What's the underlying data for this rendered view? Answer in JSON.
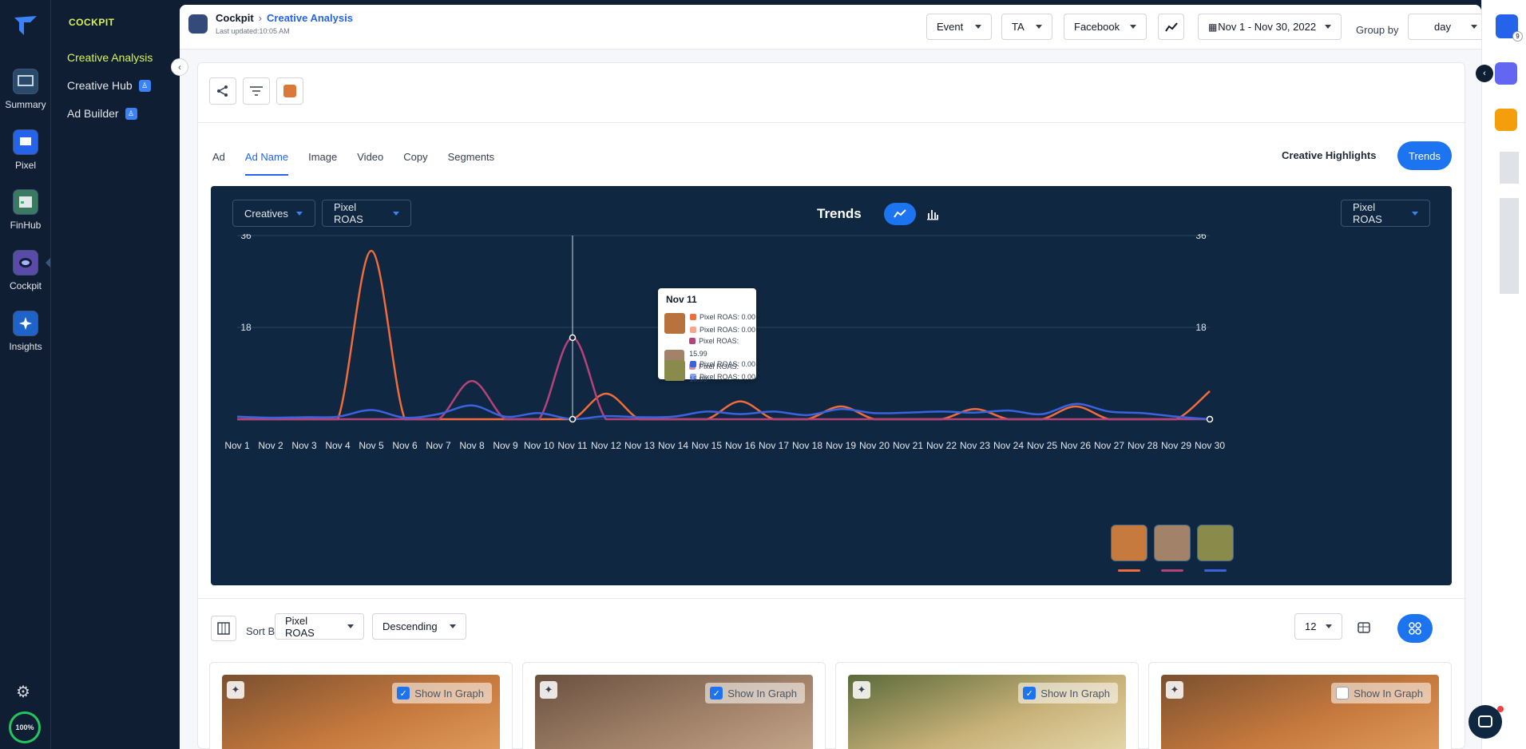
{
  "rail": {
    "items": [
      {
        "label": "Summary",
        "icon": "summary-icon"
      },
      {
        "label": "Pixel",
        "icon": "pixel-icon"
      },
      {
        "label": "FinHub",
        "icon": "finhub-icon"
      },
      {
        "label": "Cockpit",
        "icon": "cockpit-icon"
      },
      {
        "label": "Insights",
        "icon": "insights-icon"
      }
    ],
    "progress": "100%"
  },
  "sidebar": {
    "title": "COCKPIT",
    "items": [
      {
        "label": "Creative Analysis"
      },
      {
        "label": "Creative Hub"
      },
      {
        "label": "Ad Builder"
      }
    ]
  },
  "topbar": {
    "crumb_root": "Cockpit",
    "crumb_current": "Creative Analysis",
    "updated": "Last updated:10:05 AM",
    "event": "Event",
    "ta": "TA",
    "platform": "Facebook",
    "date_range": "Nov 1 - Nov 30, 2022",
    "group_by_label": "Group by",
    "group_by": "day",
    "avatar_badge": "9"
  },
  "tabs": [
    "Ad",
    "Ad Name",
    "Image",
    "Video",
    "Copy",
    "Segments"
  ],
  "active_tab": "Ad Name",
  "creative_highlights": "Creative Highlights",
  "trends_button": "Trends",
  "chart_panel": {
    "creatives_dd": "Creatives",
    "metric_dd": "Pixel ROAS",
    "title": "Trends",
    "right_metric_dd": "Pixel ROAS"
  },
  "tooltip": {
    "date": "Nov 11",
    "rows": [
      {
        "a": "Pixel ROAS:  0.00",
        "b": "Pixel ROAS:  0.00"
      },
      {
        "a": "Pixel ROAS:  15.99",
        "b": "Pixel ROAS:  15.99"
      },
      {
        "a": "Pixel ROAS:  0.00",
        "b": "Pixel ROAS:  0.00"
      }
    ]
  },
  "chart_data": {
    "type": "line",
    "x": [
      "Nov 1",
      "Nov 2",
      "Nov 3",
      "Nov 4",
      "Nov 5",
      "Nov 6",
      "Nov 7",
      "Nov 8",
      "Nov 9",
      "Nov 10",
      "Nov 11",
      "Nov 12",
      "Nov 13",
      "Nov 14",
      "Nov 15",
      "Nov 16",
      "Nov 17",
      "Nov 18",
      "Nov 19",
      "Nov 20",
      "Nov 21",
      "Nov 22",
      "Nov 23",
      "Nov 24",
      "Nov 25",
      "Nov 26",
      "Nov 27",
      "Nov 28",
      "Nov 29",
      "Nov 30"
    ],
    "ylim": [
      0,
      36
    ],
    "yticks": [
      0,
      18,
      36
    ],
    "y2ticks": [
      0,
      18,
      36
    ],
    "series": [
      {
        "color": "#f26b3a",
        "values": [
          0,
          0,
          0,
          0,
          33,
          0,
          0,
          0,
          0,
          0,
          0,
          5,
          0,
          0,
          0,
          3.5,
          0,
          0,
          2.5,
          0,
          0,
          0,
          2,
          0,
          0,
          2.5,
          0,
          0,
          0,
          5.5
        ]
      },
      {
        "color": "#b4437a",
        "values": [
          0,
          0,
          0,
          0,
          0,
          0,
          0,
          7.5,
          0,
          0,
          15.99,
          0,
          0,
          0,
          0,
          0,
          0,
          0,
          0,
          0,
          0,
          0,
          0,
          0,
          0,
          0,
          0,
          0,
          0,
          0
        ]
      },
      {
        "color": "#3b63e0",
        "values": [
          0.5,
          0.3,
          0.4,
          0.5,
          1.8,
          0.3,
          1.0,
          2.7,
          0.5,
          1.2,
          0,
          0.6,
          0.4,
          0.5,
          1.5,
          1.0,
          1.5,
          0.8,
          2.0,
          1.2,
          1.3,
          1.5,
          1.3,
          1.7,
          1.0,
          3.0,
          1.5,
          1.2,
          0.5,
          0
        ]
      }
    ]
  },
  "sort_bar": {
    "sort_by_label": "Sort By",
    "sort_field": "Pixel ROAS",
    "sort_order": "Descending",
    "per_page": "12"
  },
  "cards": [
    {
      "show_label": "Show In Graph",
      "checked": true,
      "color": "#c77a3e"
    },
    {
      "show_label": "Show In Graph",
      "checked": true,
      "color": "#a2836a"
    },
    {
      "show_label": "Show In Graph",
      "checked": true,
      "color": "#c9b27a"
    },
    {
      "show_label": "Show In Graph",
      "checked": false,
      "color": "#c77a3e"
    }
  ]
}
